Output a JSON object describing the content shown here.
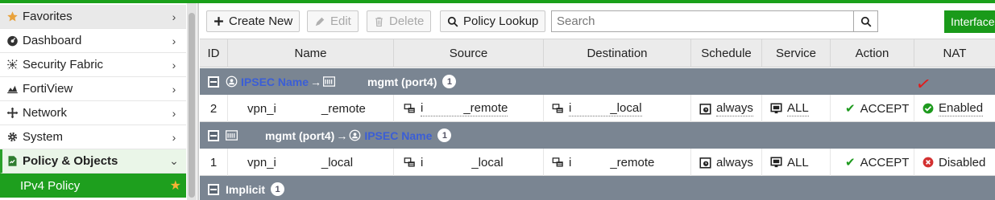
{
  "sidebar": {
    "items": [
      {
        "label": "Favorites",
        "icon": "star-icon"
      },
      {
        "label": "Dashboard",
        "icon": "dashboard-icon"
      },
      {
        "label": "Security Fabric",
        "icon": "fabric-icon"
      },
      {
        "label": "FortiView",
        "icon": "chart-icon"
      },
      {
        "label": "Network",
        "icon": "network-icon"
      },
      {
        "label": "System",
        "icon": "gear-icon"
      },
      {
        "label": "Policy & Objects",
        "icon": "policy-icon"
      }
    ],
    "active_sub": {
      "label": "IPv4 Policy"
    }
  },
  "toolbar": {
    "create_label": "Create New",
    "edit_label": "Edit",
    "delete_label": "Delete",
    "lookup_label": "Policy Lookup",
    "search_placeholder": "Search",
    "interface_label": "Interface"
  },
  "table": {
    "headers": [
      "ID",
      "Name",
      "Source",
      "Destination",
      "Schedule",
      "Service",
      "Action",
      "NAT"
    ],
    "groups": [
      {
        "from": "IPSEC Name",
        "to": "mgmt (port4)",
        "count": "1",
        "rows": [
          {
            "id": "2",
            "name_a": "vpn_i",
            "name_b": "_remote",
            "src_a": "i",
            "src_b": "_remote",
            "dst_a": "i",
            "dst_b": "_local",
            "schedule": "always",
            "service": "ALL",
            "action": "ACCEPT",
            "nat": "Enabled"
          }
        ]
      },
      {
        "from": "mgmt (port4)",
        "to": "IPSEC Name",
        "count": "1",
        "rows": [
          {
            "id": "1",
            "name_a": "vpn_i",
            "name_b": "_local",
            "src_a": "i",
            "src_b": "_local",
            "dst_a": "i",
            "dst_b": "_remote",
            "schedule": "always",
            "service": "ALL",
            "action": "ACCEPT",
            "nat": "Disabled"
          }
        ]
      },
      {
        "label": "Implicit",
        "count": "1"
      }
    ]
  },
  "colors": {
    "brand_green": "#1a9a1a",
    "group_bar": "#7a8592",
    "ipsec_blue": "#3b5ed6",
    "accept_green": "#1e9a1e",
    "disabled_red": "#d33131"
  }
}
